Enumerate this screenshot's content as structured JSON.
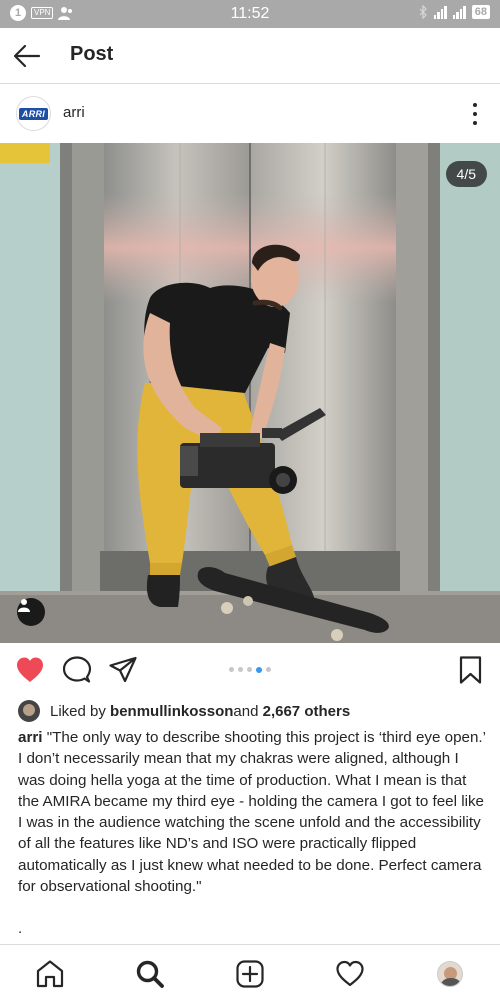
{
  "status_bar": {
    "notification_count": "1",
    "vpn_label": "VPN",
    "time": "11:52",
    "battery": "68"
  },
  "header": {
    "title": "Post"
  },
  "author": {
    "logo_text": "ARRI",
    "username": "arri"
  },
  "photo": {
    "counter": "4/5"
  },
  "carousel": {
    "total": 5,
    "active_index": 3
  },
  "likes": {
    "prefix": "Liked by ",
    "user": "benmullinkosson",
    "middle": " and ",
    "others": "2,667 others"
  },
  "caption": {
    "username": "arri",
    "text": " \"The only way to describe shooting this project is ‘third eye open.’ I don’t necessarily mean that my chakras were aligned, although I was doing hella yoga at the time of production. What I mean is that the AMIRA became my third eye - holding the camera I got to feel like I was in the audience watching the scene unfold and the accessibility of all the features like ND’s and ISO were practically flipped automatically as I just knew what needed to be done. Perfect camera for observational shooting.\"",
    "trailing": "."
  },
  "colors": {
    "like_red": "#ed4956",
    "dot_active": "#3897f0",
    "status_bar_bg": "#a9a9a9"
  },
  "icons": {
    "back": "arrow-left-icon",
    "more": "more-vertical-icon",
    "like": "heart-filled-icon",
    "comment": "comment-icon",
    "share": "paper-plane-icon",
    "save": "bookmark-icon",
    "home": "home-icon",
    "search": "search-icon",
    "add": "add-post-icon",
    "activity": "heart-outline-icon",
    "tag": "user-tag-icon"
  }
}
